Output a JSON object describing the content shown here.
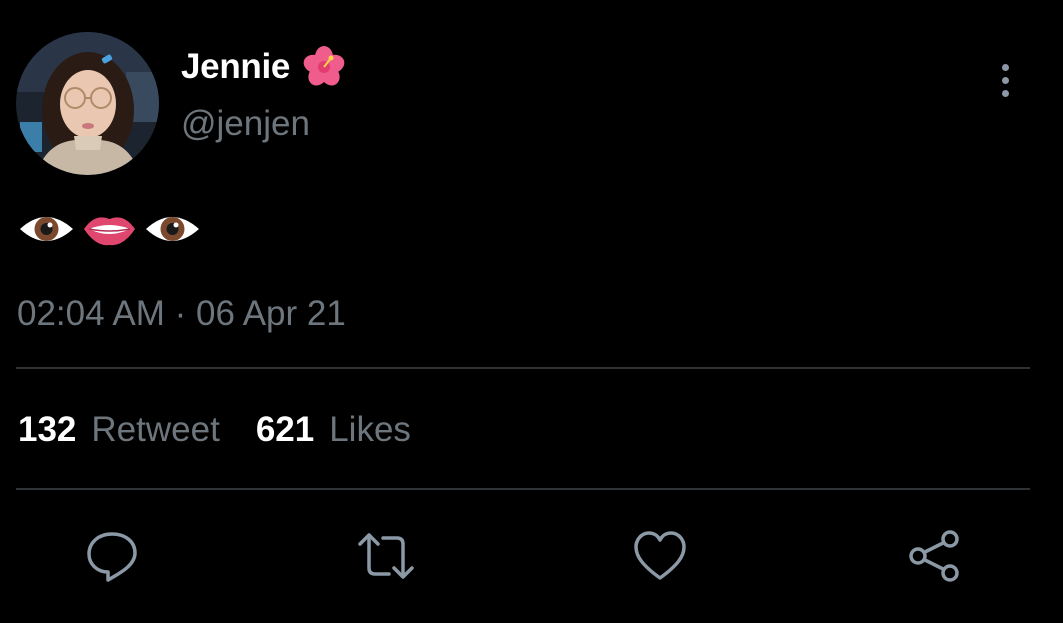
{
  "author": {
    "display_name": "Jennie",
    "handle": "@jenjen",
    "name_badge_icon": "hibiscus-flower-emoji",
    "avatar_icon": "profile-photo"
  },
  "tweet": {
    "body_emojis": [
      "eye-emoji",
      "mouth-emoji",
      "eye-emoji"
    ],
    "timestamp": "02:04 AM · 06 Apr 21"
  },
  "stats": {
    "retweet_count": "132",
    "retweet_label": "Retweet",
    "likes_count": "621",
    "likes_label": "Likes"
  },
  "actions": [
    {
      "icon": "reply-icon"
    },
    {
      "icon": "retweet-icon"
    },
    {
      "icon": "like-icon"
    },
    {
      "icon": "share-icon"
    }
  ],
  "colors": {
    "background": "#000000",
    "primary_text": "#ffffff",
    "secondary_text": "#6e767d",
    "divider": "#2f3336",
    "icon": "#8b98a5"
  }
}
